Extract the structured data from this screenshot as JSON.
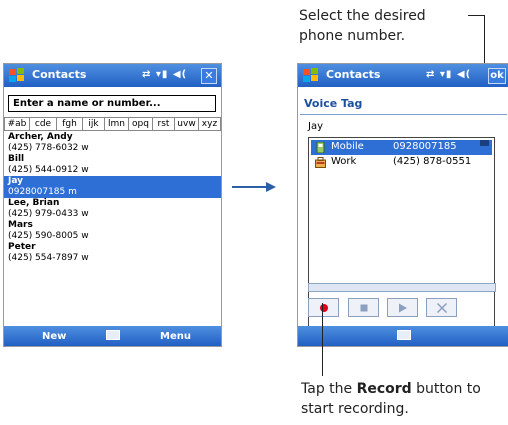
{
  "annotations": {
    "top_callout": [
      "Select the desired",
      "phone number."
    ],
    "bottom_callout_prefix": "Tap the ",
    "bottom_callout_bold": "Record",
    "bottom_callout_suffix": " button to",
    "bottom_callout_line2": "start recording."
  },
  "left_screen": {
    "title": "Contacts",
    "search_placeholder": "Enter a name or number...",
    "alpha_tabs": [
      "#ab",
      "cde",
      "fgh",
      "ijk",
      "lmn",
      "opq",
      "rst",
      "uvw",
      "xyz"
    ],
    "contacts": [
      {
        "name": "Archer, Andy",
        "detail": "(425) 778-6032   w",
        "selected": false
      },
      {
        "name": "Bill",
        "detail": "(425) 544-0912   w",
        "selected": false
      },
      {
        "name": "Jay",
        "detail": "0928007185   m",
        "selected": true
      },
      {
        "name": "Lee, Brian",
        "detail": "(425) 979-0433   w",
        "selected": false
      },
      {
        "name": "Mars",
        "detail": "(425) 590-8005   w",
        "selected": false
      },
      {
        "name": "Peter",
        "detail": "(425) 554-7897   w",
        "selected": false
      }
    ],
    "softkeys": {
      "left": "New",
      "right": "Menu"
    }
  },
  "right_screen": {
    "title": "Contacts",
    "ok_label": "ok",
    "heading": "Voice Tag",
    "contact_name": "Jay",
    "numbers": [
      {
        "label": "Mobile",
        "value": "0928007185",
        "icon": "mobile-phone-icon",
        "selected": true
      },
      {
        "label": "Work",
        "value": "(425) 878-0551",
        "icon": "work-phone-icon",
        "selected": false
      }
    ],
    "controls": [
      "record-icon",
      "stop-icon",
      "play-icon",
      "delete-icon"
    ]
  },
  "colors": {
    "titlebar": "#2e6fd6",
    "selection": "#2e6fd6",
    "record": "#e0001b"
  }
}
